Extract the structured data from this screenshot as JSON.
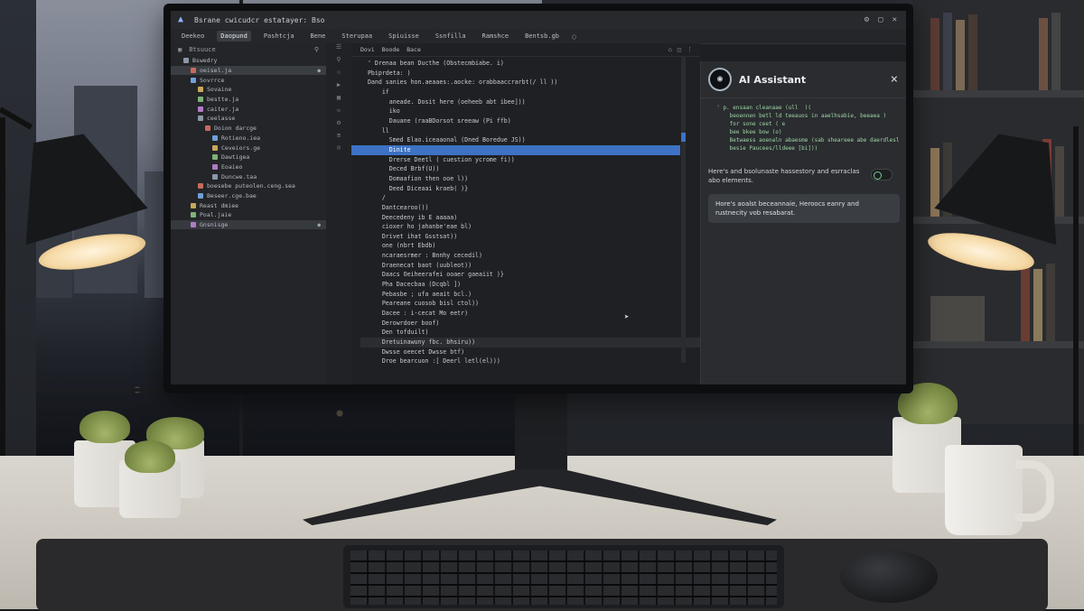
{
  "ide": {
    "title": "Bsrane cwicudcr estatayer: Bso",
    "menu": [
      "Deekeo",
      "Daopund",
      "Pashtcja",
      "Bene",
      "Sterupaa",
      "Spiuisse",
      "Ssnfilla",
      "Ramshce",
      "Bentsb.gb"
    ],
    "active_menu_index": 1,
    "sidebar_header": [
      "Btsuuce"
    ],
    "file_tree": [
      {
        "label": "Bswedry",
        "indent": 1
      },
      {
        "label": "oeisel.ja",
        "indent": 2,
        "state": "active",
        "badge": "●"
      },
      {
        "label": "Sovrrce",
        "indent": 2
      },
      {
        "label": "Sovaine",
        "indent": 3
      },
      {
        "label": "bestte.ja",
        "indent": 3
      },
      {
        "label": "caiter.ja",
        "indent": 3
      },
      {
        "label": "ceelasse",
        "indent": 3
      },
      {
        "label": "Doion darcge",
        "indent": 4
      },
      {
        "label": "Rotieno.iea",
        "indent": 5
      },
      {
        "label": "Ceveiors.ge",
        "indent": 5
      },
      {
        "label": "Dawtigea",
        "indent": 5
      },
      {
        "label": "Eoaieo",
        "indent": 5
      },
      {
        "label": "Duncwe.taa",
        "indent": 5
      },
      {
        "label": "boesebe puteolen.ceng.sea",
        "indent": 3
      },
      {
        "label": "Beseer.cge.bae",
        "indent": 3
      },
      {
        "label": "Reast dmiee",
        "indent": 2
      },
      {
        "label": "Poal.jaie",
        "indent": 2
      },
      {
        "label": "Gnsnisge",
        "indent": 2,
        "state": "selected",
        "badge": "●"
      }
    ],
    "editor_tabs": [
      "Dovi",
      "Boode",
      "Bace"
    ],
    "code_lines": [
      "  ' Drenaa bean Ducthe (Obstecmbiabe. i)",
      "  Pbiprdeta: )",
      "  Dand sanies hon.aeaaes:.aocke: orabbaaccrarbt(/ ll ))",
      "      if",
      "        aneade. Dosit here (oeheeb abt ibee]))",
      "        iko",
      "        Dauane (raaBDorsot sreeaw (Pi ffb)",
      "      ll",
      "        Smed Elao.iceaaonal (Dned Boredue JS))",
      "        Dinite",
      "        Drerse Deetl ( cuestion ycrome fi))",
      "        Deced Brbf(U))",
      "        Domaafion then ooe l))",
      "        Deed Diceaai kraeb( )}",
      "      /",
      "      Dantcearoo())",
      "      Deecedeny ib E aaaaa)",
      "      cioxer ho jahanbe'eae bl)",
      "      Drivet ihat Gsstsat))",
      "      one (nbrt Ebdb)",
      "      ncaraesrmer : Bnnhy cecedil)",
      "      Draenecat baot (uubleot))",
      "      Daacs Oeiheerafei ooaer gaeaiit )}",
      "      Pha Dacecbaa (Dcqbl ])",
      "      Pebasbe ; ufa aeait bcl.)",
      "      Peareane cuosob bisl ctol))",
      "      Dacee : i-cecat Mo eetr)",
      "      Derowrdoer boof)",
      "      Den tofduilt)",
      "      Dretuinawuny fbc. bhsiru))",
      "      Dwsse oeecet Dwsse btf)",
      "      Droe bearcuon :[ Deerl letl(el)))"
    ],
    "highlighted_line_index": 9,
    "marked_line_index": 29,
    "ai_panel": {
      "title": "AI Assistant",
      "close_glyph": "×",
      "snippet": [
        "  ' p. ensaan cleanaae (ull  )(",
        "      beoennen betl ld teeauos in aaelhsabie, beeaea )",
        "      for sone ceet ( e",
        "      bee bkee bow (o)",
        "      Betwaess aoenaln abaesme (sab sheareee abe daerdlesl",
        "      besie Paucees/lldeee [bi]))"
      ],
      "message": "Here's and bsolunaste hassestory and esrraclas abo elements.",
      "bubble": "Hore's aoalst beceannaie, Heroocs eanry and rustnecity vob resabarat."
    },
    "colors": {
      "accent": "#3d72c4",
      "toggle": "#6fd18a"
    }
  }
}
